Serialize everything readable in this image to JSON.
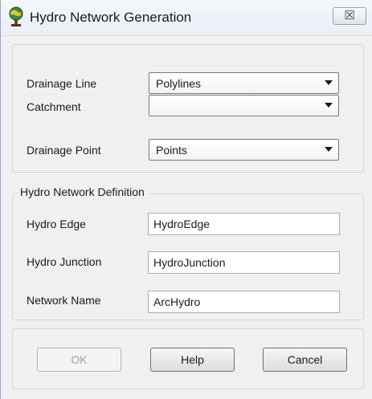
{
  "window": {
    "title": "Hydro Network Generation",
    "close_glyph": "☒",
    "icon": "arc-hydro-globe-icon"
  },
  "inputs": {
    "drainage_line": {
      "label": "Drainage Line",
      "value": "Polylines"
    },
    "catchment": {
      "label": "Catchment",
      "value": ""
    },
    "drainage_point": {
      "label": "Drainage Point",
      "value": "Points"
    }
  },
  "definition": {
    "legend": "Hydro Network Definition",
    "hydro_edge": {
      "label": "Hydro Edge",
      "value": "HydroEdge"
    },
    "hydro_junction": {
      "label": "Hydro Junction",
      "value": "HydroJunction"
    },
    "network_name": {
      "label": "Network Name",
      "value": "ArcHydro"
    }
  },
  "buttons": {
    "ok": "OK",
    "help": "Help",
    "cancel": "Cancel"
  }
}
